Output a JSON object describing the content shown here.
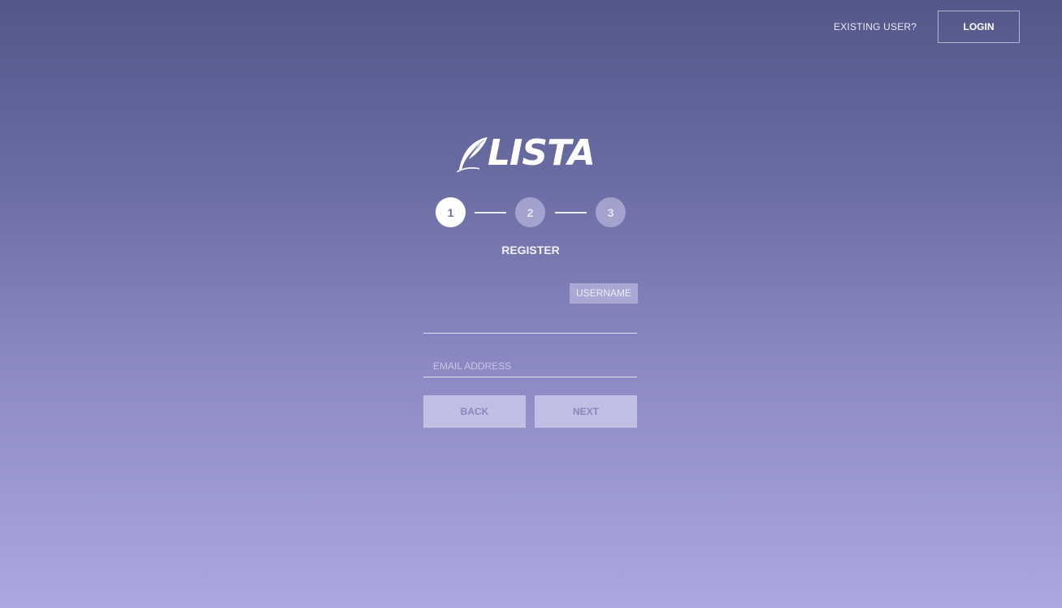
{
  "header": {
    "existing_user_label": "EXISTING USER?",
    "login_label": "LOGIN"
  },
  "brand": {
    "name": "LISTA",
    "logo_icon": "feather-quill-icon"
  },
  "stepper": {
    "steps": [
      {
        "label": "1",
        "state": "active"
      },
      {
        "label": "2",
        "state": "inactive"
      },
      {
        "label": "3",
        "state": "inactive"
      }
    ],
    "current_step": 1
  },
  "form": {
    "title": "REGISTER",
    "username": {
      "label": "USERNAME",
      "value": ""
    },
    "email": {
      "placeholder": "EMAIL ADDRESS",
      "value": ""
    },
    "back_label": "BACK",
    "next_label": "NEXT"
  },
  "colors": {
    "background_top": "#535789",
    "background_bottom": "#aba8df",
    "button_bg": "#cdcbec",
    "button_text": "#8886bb"
  }
}
